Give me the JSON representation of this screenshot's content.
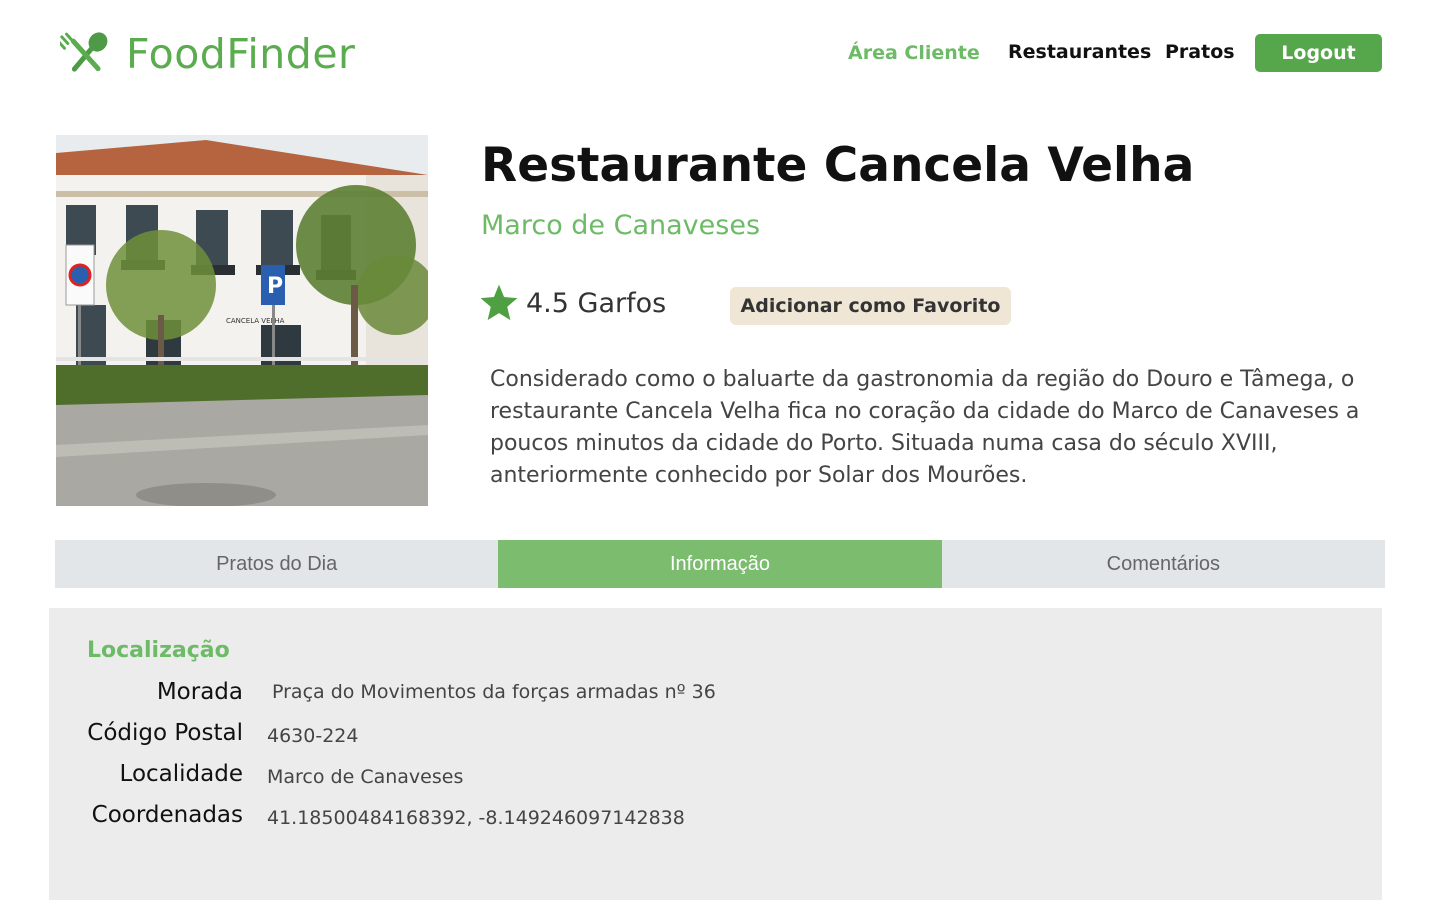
{
  "header": {
    "brand": "FoodFinder",
    "nav": {
      "area_cliente": "Área Cliente",
      "restaurantes": "Restaurantes",
      "pratos": "Pratos"
    },
    "logout_label": "Logout"
  },
  "restaurant": {
    "name": "Restaurante Cancela Velha",
    "city": "Marco de Canaveses",
    "rating_text": "4.5 Garfos",
    "favorite_label": "Adicionar como Favorito",
    "description": "Considerado como o baluarte da gastronomia da região do Douro e Tâmega, o restaurante Cancela Velha fica no coração da cidade do Marco de Canaveses a poucos minutos da cidade do Porto. Situada numa casa do século XVIII, anteriormente conhecido por Solar dos Mourões.",
    "photo_sign_text": "CANCELA VELHA",
    "photo_parking": "P"
  },
  "tabs": [
    {
      "label": "Pratos do Dia"
    },
    {
      "label": "Informação"
    },
    {
      "label": "Comentários"
    }
  ],
  "info": {
    "section_title": "Localização",
    "rows": [
      {
        "label": "Morada",
        "value": "Praça do Movimentos da forças armadas nº 36"
      },
      {
        "label": "Código Postal",
        "value": "4630-224"
      },
      {
        "label": "Localidade",
        "value": "Marco de Canaveses"
      },
      {
        "label": "Coordenadas",
        "value": "41.18500484168392, -8.149246097142838"
      }
    ]
  },
  "colors": {
    "brand_green": "#5aac4e",
    "accent_green": "#6dbb66",
    "active_tab": "#7bbc6f",
    "favorite_bg": "#efe6d6",
    "panel_bg": "#ececec"
  },
  "icons": [
    "fork-spoon-logo-icon",
    "star-icon"
  ]
}
